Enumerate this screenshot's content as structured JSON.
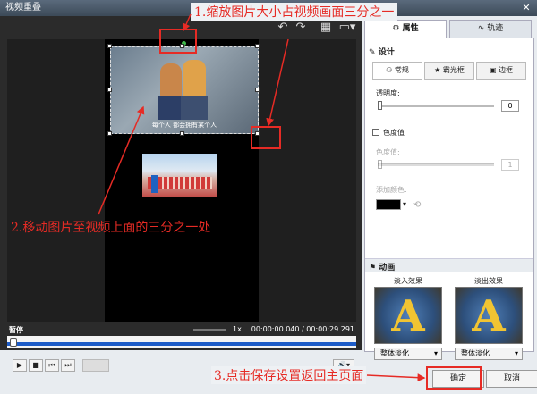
{
  "window": {
    "title": "视频重叠",
    "close": "✕"
  },
  "toolbar": {
    "undo": "↶",
    "redo": "↷",
    "grid": "▦",
    "monitor": "▭▾"
  },
  "preview": {
    "overlay_caption": "每个人 都会拥有某个人",
    "status_label": "暂停",
    "zoom": "1x",
    "time": "00:00:00.040 / 00:00:29.291",
    "progress": 0.0
  },
  "controls": {
    "play": "▶",
    "stop": "■",
    "prev": "⏮",
    "next": "⏭",
    "volume": "🔊▾"
  },
  "right_panel": {
    "tabs": [
      "属性",
      "轨迹"
    ],
    "design_header": "设计",
    "subtabs": [
      "常规",
      "霸光框",
      "边框"
    ],
    "opacity_label": "透明度:",
    "opacity_value": "0",
    "chroma_label": "色度值",
    "chroma_value_label": "色度值:",
    "chroma_value": "1",
    "add_color_label": "添加颜色:",
    "anim_header": "动画",
    "fade_in_label": "淡入效果",
    "fade_out_label": "淡出效果",
    "fade_in_option": "整体淡化",
    "fade_out_option": "整体淡化"
  },
  "buttons": {
    "ok": "确定",
    "cancel": "取消"
  },
  "annotations": {
    "a1": "1.缩放图片大小占视频画面三分之一",
    "a2": "2.移动图片至视频上面的三分之一处",
    "a3": "3.点击保存设置返回主页面"
  },
  "colors": {
    "accent_red": "#e62b25",
    "timeline_blue": "#1d5cc8"
  }
}
